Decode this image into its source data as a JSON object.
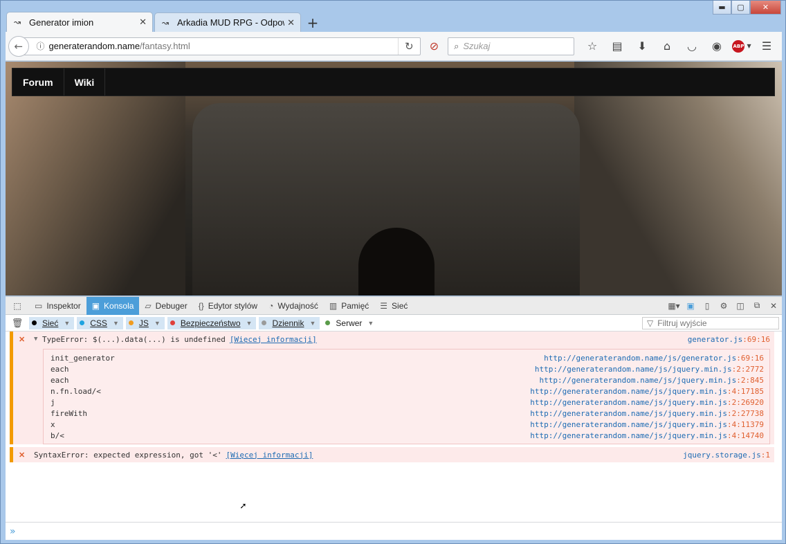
{
  "window": {
    "min_icon": "window-minimize-icon",
    "max_icon": "window-maximize-icon",
    "close_icon": "window-close-icon",
    "min_glyph": "▬",
    "max_glyph": "▢",
    "close_glyph": "✕"
  },
  "tabs": [
    {
      "label": "Generator imion",
      "icon": "↝",
      "close": "✕",
      "active": true
    },
    {
      "label": "Arkadia MUD RPG - Odpowie",
      "icon": "↝",
      "close": "✕",
      "active": false
    }
  ],
  "new_tab": "+",
  "navbar": {
    "back_glyph": "←",
    "info_glyph": "ⓘ",
    "url_host": "generaterandom.name",
    "url_path": "/fantasy.html",
    "reload_glyph": "↻",
    "blocker_glyph": "⊘",
    "search_placeholder": "Szukaj",
    "search_glyph": "⌕",
    "toolbar_icons": [
      {
        "name": "bookmark-star-icon",
        "glyph": "☆"
      },
      {
        "name": "reading-list-icon",
        "glyph": "▤"
      },
      {
        "name": "download-icon",
        "glyph": "⬇"
      },
      {
        "name": "home-icon",
        "glyph": "⌂"
      },
      {
        "name": "pocket-icon",
        "glyph": "◡"
      },
      {
        "name": "extension-icon",
        "glyph": "◉"
      }
    ],
    "abp_label": "ABP",
    "menu_glyph": "☰"
  },
  "site_nav": [
    "Forum",
    "Wiki"
  ],
  "devtools": {
    "tabs": [
      {
        "label": "Inspektor",
        "icon": "▭"
      },
      {
        "label": "Konsola",
        "icon": "▣",
        "active": true
      },
      {
        "label": "Debuger",
        "icon": "▱"
      },
      {
        "label": "Edytor stylów",
        "icon": "{}"
      },
      {
        "label": "Wydajność",
        "icon": "◔"
      },
      {
        "label": "Pamięć",
        "icon": "▥"
      },
      {
        "label": "Sieć",
        "icon": "☰"
      }
    ],
    "pick_icon": "⬚",
    "filters": [
      {
        "label": "Sieć",
        "color": "#000000"
      },
      {
        "label": "CSS",
        "color": "#1ea4e0"
      },
      {
        "label": "JS",
        "color": "#f09c20"
      },
      {
        "label": "Bezpieczeństwo",
        "color": "#e0403a"
      },
      {
        "label": "Dziennik",
        "color": "#9a9a9a"
      },
      {
        "label": "Serwer",
        "color": "#5a9b4a",
        "off": true
      }
    ],
    "filter_placeholder": "Filtruj wyjście",
    "filter_glyph": "▽",
    "trash_glyph": "🗑",
    "messages": [
      {
        "text": "TypeError: $(...).data(...) is undefined",
        "more": "[Więcej informacji]",
        "file": "generator.js",
        "pos": ":69:16",
        "twisty": "▼",
        "stack": [
          {
            "fn": "init_generator",
            "url": "http://generaterandom.name/js/generator.js",
            "pos": ":69:16"
          },
          {
            "fn": "each",
            "url": "http://generaterandom.name/js/jquery.min.js",
            "pos": ":2:2772"
          },
          {
            "fn": "each",
            "url": "http://generaterandom.name/js/jquery.min.js",
            "pos": ":2:845"
          },
          {
            "fn": "n.fn.load/<",
            "url": "http://generaterandom.name/js/jquery.min.js",
            "pos": ":4:17185"
          },
          {
            "fn": "j",
            "url": "http://generaterandom.name/js/jquery.min.js",
            "pos": ":2:26920"
          },
          {
            "fn": "fireWith",
            "url": "http://generaterandom.name/js/jquery.min.js",
            "pos": ":2:27738"
          },
          {
            "fn": "x",
            "url": "http://generaterandom.name/js/jquery.min.js",
            "pos": ":4:11379"
          },
          {
            "fn": "b/<",
            "url": "http://generaterandom.name/js/jquery.min.js",
            "pos": ":4:14740"
          }
        ]
      },
      {
        "text": "SyntaxError: expected expression, got '<'",
        "more": "[Więcej informacji]",
        "file": "jquery.storage.js",
        "pos": ":1"
      }
    ],
    "prompt": "»"
  },
  "colors": {
    "accent": "#4c9ed9",
    "error_bg": "#fdeaea",
    "error_bar": "#f29b00"
  }
}
